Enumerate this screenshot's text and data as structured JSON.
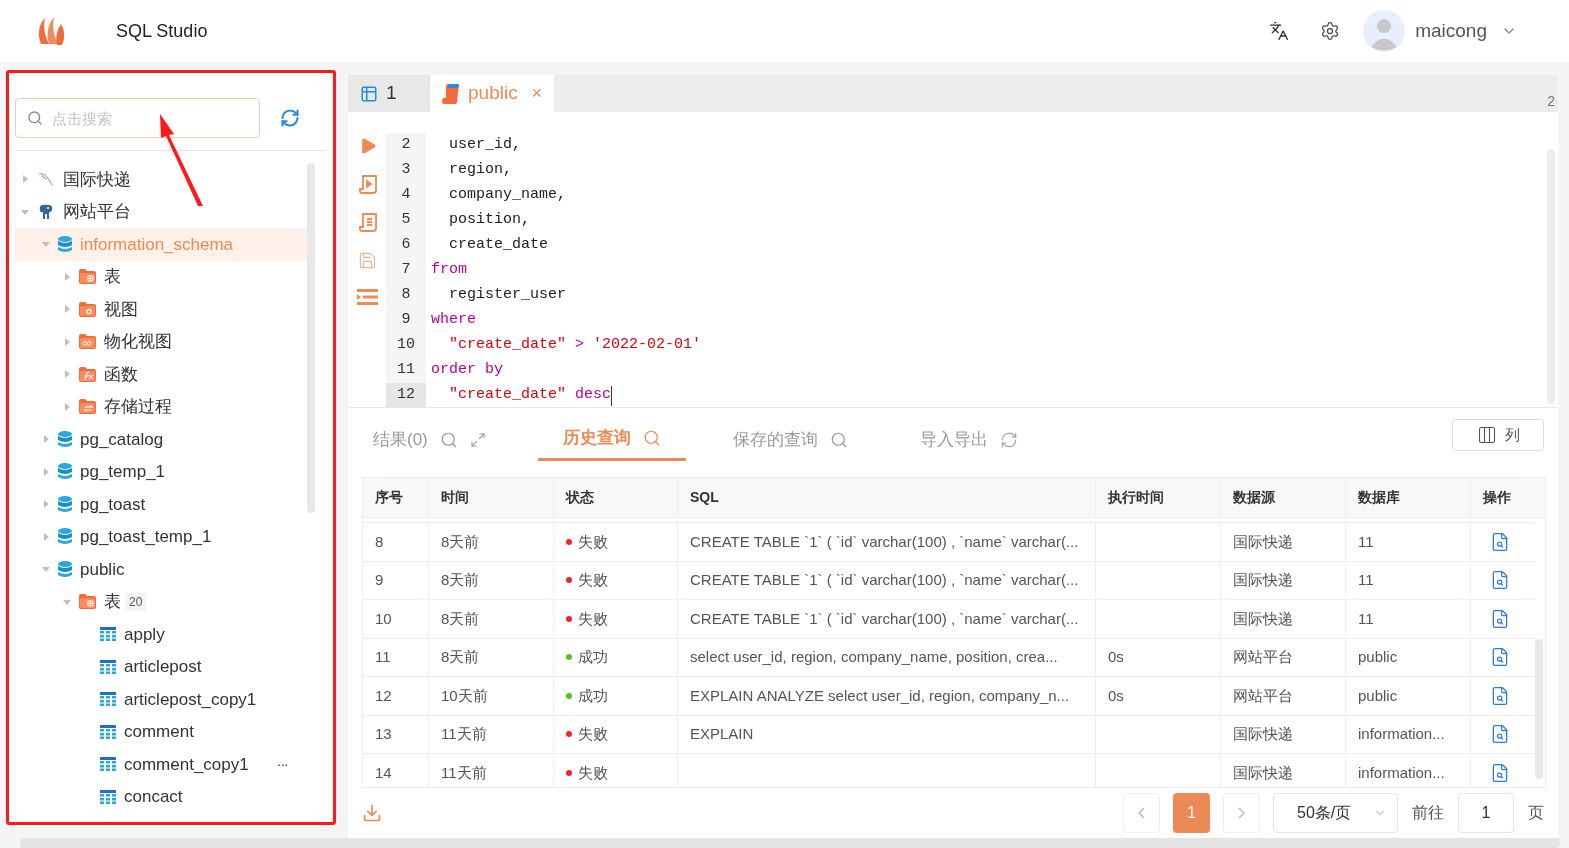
{
  "header": {
    "app_title": "SQL Studio",
    "user": {
      "name": "maicong"
    }
  },
  "sidebar": {
    "search": {
      "placeholder": "点击搜索"
    },
    "tree": [
      {
        "label": "国际快递",
        "kind": "mysql",
        "expanded": false,
        "selected": false
      },
      {
        "label": "网站平台",
        "kind": "postgres",
        "expanded": true,
        "selected": false,
        "children": [
          {
            "label": "information_schema",
            "kind": "schema",
            "expanded": true,
            "selected": true,
            "children": [
              {
                "label": "表",
                "kind": "folder-table",
                "expanded": false,
                "selected": false
              },
              {
                "label": "视图",
                "kind": "folder-view",
                "expanded": false,
                "selected": false
              },
              {
                "label": "物化视图",
                "kind": "folder-matview",
                "expanded": false,
                "selected": false
              },
              {
                "label": "函数",
                "kind": "folder-function",
                "expanded": false,
                "selected": false
              },
              {
                "label": "存储过程",
                "kind": "folder-procedure",
                "expanded": false,
                "selected": false
              }
            ]
          },
          {
            "label": "pg_catalog",
            "kind": "schema",
            "expanded": false,
            "selected": false
          },
          {
            "label": "pg_temp_1",
            "kind": "schema",
            "expanded": false,
            "selected": false
          },
          {
            "label": "pg_toast",
            "kind": "schema",
            "expanded": false,
            "selected": false
          },
          {
            "label": "pg_toast_temp_1",
            "kind": "schema",
            "expanded": false,
            "selected": false
          },
          {
            "label": "public",
            "kind": "schema",
            "expanded": true,
            "selected": false,
            "children": [
              {
                "label": "表",
                "kind": "folder-table",
                "count": "20",
                "expanded": true,
                "selected": false,
                "children": [
                  {
                    "label": "apply",
                    "kind": "table",
                    "selected": false
                  },
                  {
                    "label": "articlepost",
                    "kind": "table",
                    "selected": false
                  },
                  {
                    "label": "articlepost_copy1",
                    "kind": "table",
                    "selected": false
                  },
                  {
                    "label": "comment",
                    "kind": "table",
                    "selected": false
                  },
                  {
                    "label": "comment_copy1",
                    "kind": "table",
                    "selected": false,
                    "more": "···"
                  },
                  {
                    "label": "concact",
                    "kind": "table",
                    "selected": false
                  }
                ]
              }
            ]
          }
        ]
      }
    ]
  },
  "editor_tabs": [
    {
      "label": "1",
      "kind": "table",
      "selected": false
    },
    {
      "label": "public",
      "kind": "script",
      "selected": true,
      "close": "×"
    }
  ],
  "editor_tabs_overflow": "2",
  "editor": {
    "lines": [
      {
        "number": "2",
        "current": false,
        "tokens": [
          {
            "text": "  user_id,",
            "kind": "plain"
          }
        ]
      },
      {
        "number": "3",
        "current": false,
        "tokens": [
          {
            "text": "  region,",
            "kind": "plain"
          }
        ]
      },
      {
        "number": "4",
        "current": false,
        "tokens": [
          {
            "text": "  company_name,",
            "kind": "plain"
          }
        ]
      },
      {
        "number": "5",
        "current": false,
        "tokens": [
          {
            "text": "  position,",
            "kind": "plain"
          }
        ]
      },
      {
        "number": "6",
        "current": false,
        "tokens": [
          {
            "text": "  create_date",
            "kind": "plain"
          }
        ]
      },
      {
        "number": "7",
        "current": false,
        "tokens": [
          {
            "text": "from",
            "kind": "keyword"
          }
        ]
      },
      {
        "number": "8",
        "current": false,
        "tokens": [
          {
            "text": "  register_user",
            "kind": "plain"
          }
        ]
      },
      {
        "number": "9",
        "current": false,
        "tokens": [
          {
            "text": "where",
            "kind": "keyword"
          }
        ]
      },
      {
        "number": "10",
        "current": false,
        "tokens": [
          {
            "text": "  \"create_date\"",
            "kind": "string"
          },
          {
            "text": " > ",
            "kind": "keyword"
          },
          {
            "text": "'2022-02-01'",
            "kind": "string"
          }
        ]
      },
      {
        "number": "11",
        "current": false,
        "tokens": [
          {
            "text": "order by",
            "kind": "keyword"
          }
        ]
      },
      {
        "number": "12",
        "current": true,
        "tokens": [
          {
            "text": "  \"create_date\"",
            "kind": "string"
          },
          {
            "text": " desc",
            "kind": "keyword"
          }
        ]
      }
    ]
  },
  "result_tabs": [
    {
      "label": "结果(0)",
      "selected": false,
      "icons": [
        {
          "kind": "search"
        },
        {
          "kind": "expand"
        }
      ]
    },
    {
      "label": "历史查询",
      "selected": true,
      "icons": [
        {
          "kind": "search"
        }
      ]
    },
    {
      "label": "保存的查询",
      "selected": false,
      "icons": [
        {
          "kind": "search"
        }
      ]
    },
    {
      "label": "导入导出",
      "selected": false,
      "icons": [
        {
          "kind": "refresh"
        }
      ]
    }
  ],
  "columns_button": "列",
  "table": {
    "columns": [
      "序号",
      "时间",
      "状态",
      "SQL",
      "执行时间",
      "数据源",
      "数据库",
      "操作"
    ],
    "rows": [
      {
        "seq": "8",
        "time": "8天前",
        "status": {
          "text": "失败",
          "color": "#f5222d"
        },
        "sql": "CREATE TABLE `1` ( `id` varchar(100) , `name` varchar(...",
        "duration": "",
        "source": "国际快递",
        "database": "11"
      },
      {
        "seq": "9",
        "time": "8天前",
        "status": {
          "text": "失败",
          "color": "#f5222d"
        },
        "sql": "CREATE TABLE `1` ( `id` varchar(100) , `name` varchar(...",
        "duration": "",
        "source": "国际快递",
        "database": "11"
      },
      {
        "seq": "10",
        "time": "8天前",
        "status": {
          "text": "失败",
          "color": "#f5222d"
        },
        "sql": "CREATE TABLE `1` ( `id` varchar(100) , `name` varchar(...",
        "duration": "",
        "source": "国际快递",
        "database": "11"
      },
      {
        "seq": "11",
        "time": "8天前",
        "status": {
          "text": "成功",
          "color": "#52c41a"
        },
        "sql": "select user_id, region, company_name, position, crea...",
        "duration": "0s",
        "source": "网站平台",
        "database": "public"
      },
      {
        "seq": "12",
        "time": "10天前",
        "status": {
          "text": "成功",
          "color": "#52c41a"
        },
        "sql": "EXPLAIN ANALYZE select user_id, region, company_n...",
        "duration": "0s",
        "source": "网站平台",
        "database": "public"
      },
      {
        "seq": "13",
        "time": "11天前",
        "status": {
          "text": "失败",
          "color": "#f5222d"
        },
        "sql": "EXPLAIN",
        "duration": "",
        "source": "国际快递",
        "database": "information..."
      },
      {
        "seq": "14",
        "time": "11天前",
        "status": {
          "text": "失败",
          "color": "#f5222d"
        },
        "sql": "",
        "duration": "",
        "source": "国际快递",
        "database": "information..."
      }
    ]
  },
  "pagination": {
    "pages": [
      {
        "label": "1",
        "selected": true
      }
    ],
    "page_size": "50条/页",
    "goto_label": "前往",
    "goto_value": "1",
    "page_suffix": "页"
  }
}
